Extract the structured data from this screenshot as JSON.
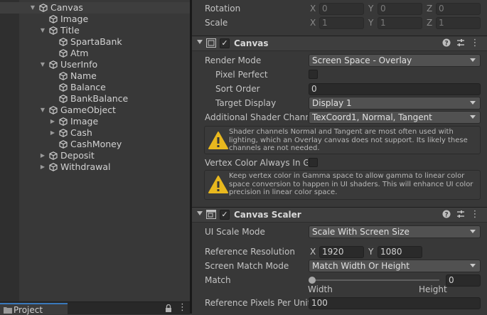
{
  "hierarchy": {
    "items": [
      {
        "label": "Canvas",
        "depth": 0,
        "expanded": true,
        "has_children": true,
        "selected": true
      },
      {
        "label": "Image",
        "depth": 1,
        "has_children": false
      },
      {
        "label": "Title",
        "depth": 1,
        "expanded": true,
        "has_children": true
      },
      {
        "label": "SpartaBank",
        "depth": 2,
        "has_children": false
      },
      {
        "label": "Atm",
        "depth": 2,
        "has_children": false
      },
      {
        "label": "UserInfo",
        "depth": 1,
        "expanded": true,
        "has_children": true
      },
      {
        "label": "Name",
        "depth": 2,
        "has_children": false
      },
      {
        "label": "Balance",
        "depth": 2,
        "has_children": false
      },
      {
        "label": "BankBalance",
        "depth": 2,
        "has_children": false
      },
      {
        "label": "GameObject",
        "depth": 1,
        "expanded": true,
        "has_children": true
      },
      {
        "label": "Image",
        "depth": 2,
        "expanded": false,
        "has_children": true
      },
      {
        "label": "Cash",
        "depth": 2,
        "expanded": false,
        "has_children": true
      },
      {
        "label": "CashMoney",
        "depth": 2,
        "has_children": false
      },
      {
        "label": "Deposit",
        "depth": 1,
        "expanded": false,
        "has_children": true
      },
      {
        "label": "Withdrawal",
        "depth": 1,
        "expanded": false,
        "has_children": true
      }
    ]
  },
  "project_tab": {
    "label": "Project"
  },
  "transform": {
    "rotation": {
      "label": "Rotation",
      "x": "0",
      "y": "0",
      "z": "0"
    },
    "scale": {
      "label": "Scale",
      "x": "1",
      "y": "1",
      "z": "1"
    },
    "axis_x": "X",
    "axis_y": "Y",
    "axis_z": "Z"
  },
  "canvas": {
    "title": "Canvas",
    "render_mode": {
      "label": "Render Mode",
      "value": "Screen Space - Overlay"
    },
    "pixel_perfect": {
      "label": "Pixel Perfect"
    },
    "sort_order": {
      "label": "Sort Order",
      "value": "0"
    },
    "target_display": {
      "label": "Target Display",
      "value": "Display 1"
    },
    "shader_channels": {
      "label": "Additional Shader Channe",
      "value": "TexCoord1, Normal, Tangent"
    },
    "warning1": "Shader channels Normal and Tangent are most often used with lighting, which an Overlay canvas does not support. Its likely these channels are not needed.",
    "vertex_color": {
      "label": "Vertex Color Always In Ga"
    },
    "warning2": "Keep vertex color in Gamma space to allow gamma to linear color space conversion to happen in UI shaders. This will enhance UI color precision in linear color space."
  },
  "canvas_scaler": {
    "title": "Canvas Scaler",
    "ui_scale_mode": {
      "label": "UI Scale Mode",
      "value": "Scale With Screen Size"
    },
    "reference_resolution": {
      "label": "Reference Resolution",
      "x_label": "X",
      "x": "1920",
      "y_label": "Y",
      "y": "1080"
    },
    "screen_match_mode": {
      "label": "Screen Match Mode",
      "value": "Match Width Or Height"
    },
    "match": {
      "label": "Match",
      "value": "0",
      "min_label": "Width",
      "max_label": "Height",
      "fraction": 0
    },
    "ref_pixels_per_unit": {
      "label": "Reference Pixels Per Unit",
      "value": "100"
    }
  },
  "colors": {
    "accent": "#3a79bb",
    "warning": "#e8b81e"
  }
}
